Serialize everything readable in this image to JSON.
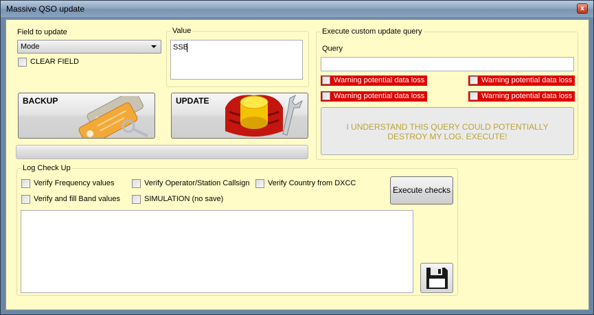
{
  "window": {
    "title": "Massive QSO update",
    "close_glyph": "x"
  },
  "field_to_update": {
    "label": "Field to update",
    "selected": "Mode",
    "clear_field_label": "CLEAR FIELD"
  },
  "value": {
    "label": "Value",
    "text": "SSB"
  },
  "buttons": {
    "backup_label": "BACKUP",
    "update_label": "UPDATE"
  },
  "custom_query": {
    "group_title": "Execute custom update query",
    "query_label": "Query",
    "query_value": "",
    "warnings": [
      "Warning potential data loss",
      "Warning potential data loss",
      "Warning potential data loss",
      "Warning potential data loss"
    ],
    "execute_label": "I UNDERSTAND THIS QUERY COULD POTENTIALLY DESTROY MY LOG. EXECUTE!",
    "warning_color": "#e00000",
    "execute_text_color": "#b9a433"
  },
  "log_check": {
    "group_title": "Log Check Up",
    "options": {
      "frequency": "Verify Frequency values",
      "operator": "Verify Operator/Station Callsign",
      "country": "Verify Country from DXCC",
      "band": "Verify and fill Band values",
      "simulation": "SIMULATION (no save)"
    },
    "execute_checks_label": "Execute checks",
    "output_text": ""
  },
  "icons": [
    "close-icon",
    "chevron-down-icon",
    "key-tags-icon",
    "database-wrench-icon",
    "floppy-disk-icon"
  ],
  "colors": {
    "client_background": "#fffcc7",
    "titlebar": "#8ea6c1"
  }
}
